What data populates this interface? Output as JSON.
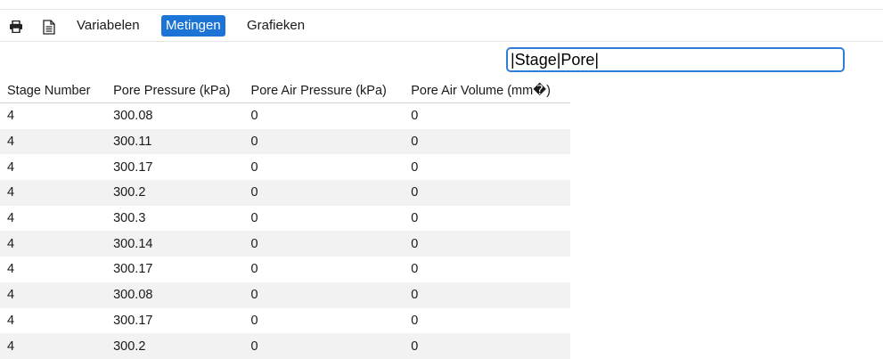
{
  "toolbar": {
    "print_icon": "printer-icon",
    "document_icon": "document-icon",
    "tabs": [
      {
        "label": "Variabelen",
        "active": false
      },
      {
        "label": "Metingen",
        "active": true
      },
      {
        "label": "Grafieken",
        "active": false
      }
    ]
  },
  "filter": {
    "value": "|Stage|Pore|"
  },
  "table": {
    "headers": [
      "Stage Number",
      "Pore Pressure (kPa)",
      "Pore Air Pressure (kPa)",
      "Pore Air Volume (mm�)"
    ],
    "rows": [
      [
        "4",
        "300.08",
        "0",
        "0"
      ],
      [
        "4",
        "300.11",
        "0",
        "0"
      ],
      [
        "4",
        "300.17",
        "0",
        "0"
      ],
      [
        "4",
        "300.2",
        "0",
        "0"
      ],
      [
        "4",
        "300.3",
        "0",
        "0"
      ],
      [
        "4",
        "300.14",
        "0",
        "0"
      ],
      [
        "4",
        "300.17",
        "0",
        "0"
      ],
      [
        "4",
        "300.08",
        "0",
        "0"
      ],
      [
        "4",
        "300.17",
        "0",
        "0"
      ],
      [
        "4",
        "300.2",
        "0",
        "0"
      ]
    ]
  },
  "colors": {
    "accent": "#1b74d6",
    "row_alt": "#f2f2f2"
  }
}
